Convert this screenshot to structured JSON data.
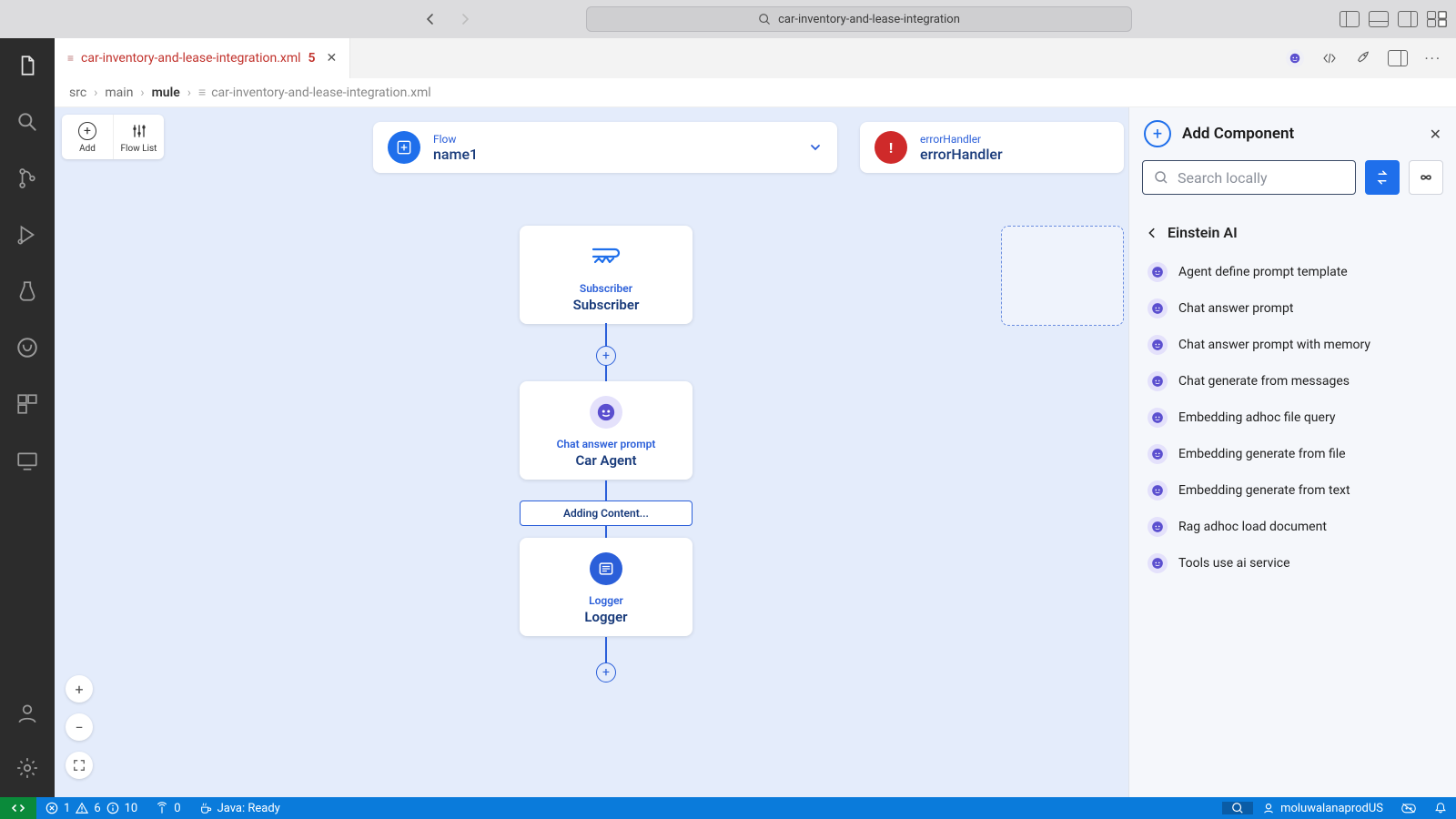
{
  "titlebar": {
    "search_text": "car-inventory-and-lease-integration"
  },
  "tab": {
    "filename": "car-inventory-and-lease-integration.xml",
    "dirty_marker": "5"
  },
  "breadcrumb": {
    "parts": [
      "src",
      "main",
      "mule"
    ],
    "leaf": "car-inventory-and-lease-integration.xml"
  },
  "toolbar": {
    "add_label": "Add",
    "flowlist_label": "Flow List"
  },
  "flow_header": {
    "type_label": "Flow",
    "name": "name1"
  },
  "error_header": {
    "type_label": "errorHandler",
    "name": "errorHandler"
  },
  "nodes": {
    "subscriber": {
      "type": "Subscriber",
      "name": "Subscriber"
    },
    "chat": {
      "type": "Chat answer prompt",
      "name": "Car Agent"
    },
    "logger": {
      "type": "Logger",
      "name": "Logger"
    }
  },
  "adding_banner": "Adding Content...",
  "sidepanel": {
    "title": "Add Component",
    "search_placeholder": "Search locally",
    "section_title": "Einstein AI",
    "items": [
      "Agent define prompt template",
      "Chat answer prompt",
      "Chat answer prompt with memory",
      "Chat generate from messages",
      "Embedding adhoc file query",
      "Embedding generate from file",
      "Embedding generate from text",
      "Rag adhoc load document",
      "Tools use ai service"
    ]
  },
  "statusbar": {
    "errors": "1",
    "warnings": "6",
    "infos": "10",
    "ports": "0",
    "java": "Java: Ready",
    "user": "moluwalanaprodUS"
  }
}
